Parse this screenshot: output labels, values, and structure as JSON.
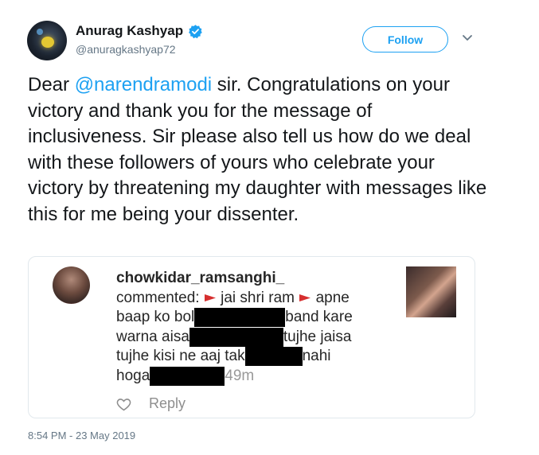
{
  "author": {
    "name": "Anurag Kashyap",
    "handle": "@anuragkashyap72",
    "verified": true
  },
  "actions": {
    "follow_label": "Follow",
    "more_icon": "chevron-down-icon"
  },
  "tweet": {
    "text_before": "Dear ",
    "mention": "@narendramodi",
    "text_after": " sir. Congratulations on your victory and thank you for the message of inclusiveness. Sir please also tell us how do we deal with these followers of yours who celebrate your victory by threatening my daughter with messages like this for me being your dissenter."
  },
  "embedded_comment": {
    "username": "chowkidar_ramsanghi_",
    "commented_label": "commented:",
    "parts": [
      "jai shri ram",
      "apne",
      "baap ko bol",
      "band kare",
      "warna aisa",
      "tujhe jaisa",
      "tujhe kisi ne aaj tak",
      "nahi",
      "hoga"
    ],
    "time_ago": "49m",
    "reply_label": "Reply",
    "flag_icon": "red-triangle-flag-icon"
  },
  "timestamp": "8:54 PM - 23 May 2019",
  "colors": {
    "accent": "#1da1f2",
    "text": "#14171a",
    "muted": "#657786"
  }
}
